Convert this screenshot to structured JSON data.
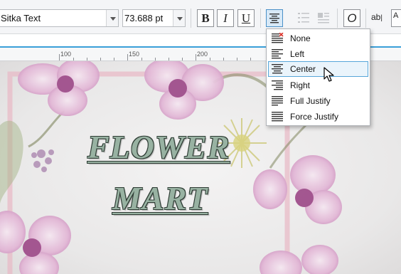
{
  "toolbar": {
    "font_name": "Sitka Text",
    "font_size": "73.688 pt",
    "bold_label": "B",
    "italic_label": "I",
    "underline_label": "U",
    "text_frame_label": "ab",
    "glyph_label": "A"
  },
  "ruler": {
    "labels": [
      "100",
      "150",
      "200"
    ]
  },
  "canvas": {
    "line1": "FLOWER",
    "line2": "MART"
  },
  "alignment_menu": {
    "items": [
      {
        "label": "None",
        "icon": "align-none-icon"
      },
      {
        "label": "Left",
        "icon": "align-left-icon"
      },
      {
        "label": "Center",
        "icon": "align-center-icon",
        "selected": true
      },
      {
        "label": "Right",
        "icon": "align-right-icon"
      },
      {
        "label": "Full Justify",
        "icon": "align-justify-icon"
      },
      {
        "label": "Force Justify",
        "icon": "align-force-justify-icon"
      }
    ]
  },
  "colors": {
    "accent": "#3a9fd8",
    "headline_fill": "#98b2a2",
    "headline_outline": "#2d3b33",
    "orchid": "#c97fb7",
    "frame_pink": "#e8b8c4"
  }
}
